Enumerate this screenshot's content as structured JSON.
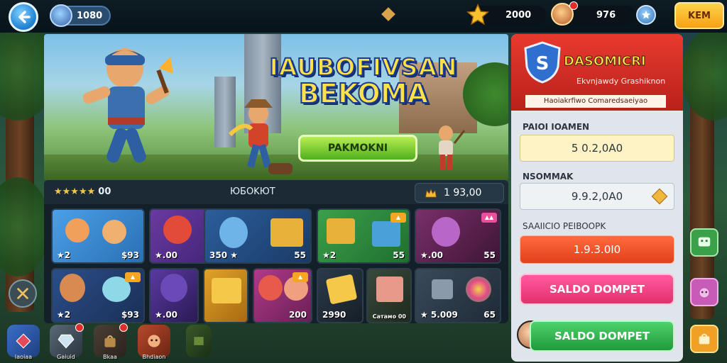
{
  "topbar": {
    "player_value": "1080",
    "star_value": "2000",
    "hero_value": "976",
    "menu_label": "KEM"
  },
  "banner": {
    "title_line1": "IAUBOFIVSAN",
    "title_line2": "BEKOMA",
    "play_label": "PAKMOKNI"
  },
  "grid": {
    "stars_rating": "★★★★★",
    "stars_count": "00",
    "title": "ЮБOKЮТ",
    "gold_value": "1 93,00",
    "cards": [
      {
        "left": "★2",
        "right": "$93",
        "badge": ""
      },
      {
        "left": "★.00",
        "right": "55",
        "badge": ""
      },
      {
        "left": "350 ★",
        "right": "55",
        "badge": ""
      },
      {
        "left": "★2",
        "right": "55",
        "badge": "▲"
      },
      {
        "left": "★.00",
        "right": "55",
        "badge": "▲▲"
      },
      {
        "left": "★2",
        "right": "$93",
        "badge": "▲"
      },
      {
        "left": "★.00",
        "right": "",
        "badge": ""
      },
      {
        "left": "",
        "right": "",
        "badge": "▲"
      },
      {
        "left": "★2",
        "right": "200",
        "badge": "▲"
      },
      {
        "left": "2990",
        "right": "",
        "badge": ""
      },
      {
        "left": "",
        "right": "Сатамо 00",
        "badge": ""
      },
      {
        "left": "★ 5.009",
        "right": "65",
        "badge": ""
      }
    ]
  },
  "side": {
    "brand": "DASOMICRI",
    "subtitle": "Ekvnjawdy Grashiknon",
    "strip": "Haoiakrfiwo Comaredsaeiyao",
    "field1_label": "PAIOI IOAMEN",
    "field1_value": "5 0.2,0A0",
    "field2_label": "NSOMMAK",
    "field2_value": "9.9.2,0A0",
    "field3_label": "SAAIICIO PEIBOOPK",
    "btn_red": "1.9.3.0I0",
    "btn_pink": "SALDO DOMPET",
    "btn_green": "SALDO DOMPET"
  },
  "nav": {
    "items": [
      {
        "label": "Iaoiaa"
      },
      {
        "label": "Gaiuid"
      },
      {
        "label": "Bkaa"
      },
      {
        "label": "Bhdiaon"
      },
      {
        "label": ""
      }
    ]
  }
}
